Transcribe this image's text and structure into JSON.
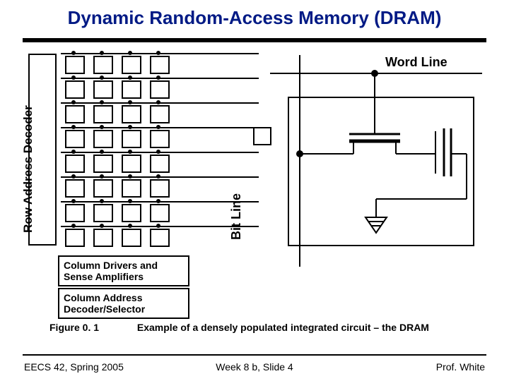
{
  "title": "Dynamic Random-Access Memory (DRAM)",
  "labels": {
    "row_decoder": "Row Address Decoder",
    "col_drivers": "Column Drivers and Sense Amplifiers",
    "col_decoder": "Column Address Decoder/Selector",
    "word_line": "Word Line",
    "bit_line": "Bit Line"
  },
  "figure": {
    "number": "Figure   0. 1",
    "caption": "Example of a densely populated integrated circuit – the DRAM"
  },
  "footer": {
    "left": "EECS 42, Spring 2005",
    "center": "Week 8 b, Slide 4",
    "right": "Prof. White"
  },
  "array": {
    "rows": 8,
    "cols": 4,
    "row_spacing": 35,
    "col_spacing": 40
  }
}
